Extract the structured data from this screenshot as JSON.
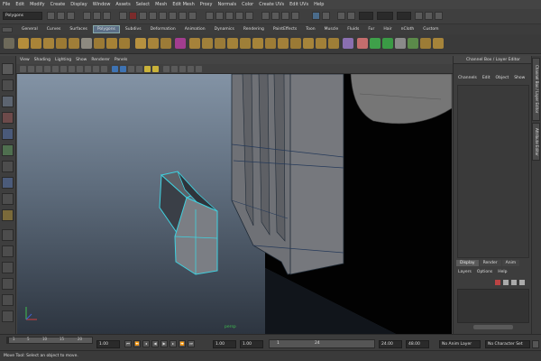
{
  "menus": [
    "File",
    "Edit",
    "Modify",
    "Create",
    "Display",
    "Window",
    "Assets",
    "Select",
    "Mesh",
    "Edit Mesh",
    "Proxy",
    "Normals",
    "Color",
    "Create UVs",
    "Edit UVs",
    "Help"
  ],
  "status_line": {
    "mode": "Polygons"
  },
  "shelf_tabs": [
    "General",
    "Curves",
    "Surfaces",
    "Polygons",
    "Subdivs",
    "Deformation",
    "Animation",
    "Dynamics",
    "Rendering",
    "PaintEffects",
    "Toon",
    "Muscle",
    "Fluids",
    "Fur",
    "Hair",
    "nCloth",
    "Custom"
  ],
  "shelf_active_tab": "Polygons",
  "panel_menu": [
    "View",
    "Shading",
    "Lighting",
    "Show",
    "Renderer",
    "Panels"
  ],
  "viewport": {
    "camera_label": "persp"
  },
  "channel_box": {
    "title": "Channel Box / Layer Editor",
    "menu": [
      "Channels",
      "Edit",
      "Object",
      "Show"
    ]
  },
  "side_tabs": [
    "Channel Box / Layer Editor",
    "Attribute Editor"
  ],
  "layer_editor": {
    "tabs": [
      "Display",
      "Render",
      "Anim"
    ],
    "active_tab": "Display",
    "menu": [
      "Layers",
      "Options",
      "Help"
    ]
  },
  "timeline": {
    "ticks": [
      "1",
      "5",
      "10",
      "15",
      "20"
    ],
    "current_frame": "1.00"
  },
  "range_slider": {
    "start": "1.00",
    "start_inner": "1.00",
    "range_start": "1",
    "range_end": "24",
    "end_inner": "24.00",
    "end": "48.00",
    "anim_layer": "No Anim Layer",
    "character_set": "No Character Set"
  },
  "help_line": "Move Tool: Select an object to move."
}
